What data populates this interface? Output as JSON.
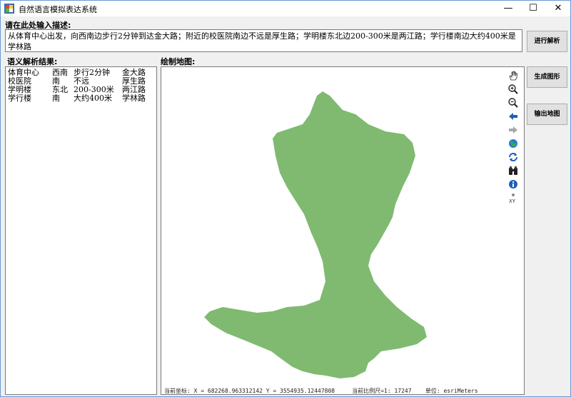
{
  "window": {
    "title": "自然语言模拟表达系统",
    "controls": {
      "minimize": "—",
      "maximize": "☐",
      "close": "✕"
    }
  },
  "labels": {
    "input_prompt": "请在此处输入描述:",
    "parse_result": "语义解析结果:",
    "draw_map": "绘制地图:"
  },
  "description": "从体育中心出发，向西南边步行2分钟到达金大路；附近的校医院南边不远是厚生路；学明楼东北边200-300米是两江路；学行楼南边大约400米是学林路",
  "results": [
    {
      "place": "体育中心",
      "direction": "西南",
      "distance": "步行2分钟",
      "road": "金大路"
    },
    {
      "place": "校医院",
      "direction": "南",
      "distance": "不远",
      "road": "厚生路"
    },
    {
      "place": "学明楼",
      "direction": "东北",
      "distance": "200-300米",
      "road": "两江路"
    },
    {
      "place": "学行楼",
      "direction": "南",
      "distance": "大约400米",
      "road": "学林路"
    }
  ],
  "buttons": {
    "parse": "进行解析",
    "generate": "生成图形",
    "export": "输出地图"
  },
  "map": {
    "fill_color": "#7fba70",
    "tools": [
      "pan-icon",
      "zoom-in-icon",
      "zoom-out-icon",
      "back-arrow-icon",
      "forward-arrow-icon",
      "globe-icon",
      "refresh-icon",
      "binoculars-icon",
      "info-icon",
      "xy-icon"
    ],
    "status": {
      "coord": "当前坐标: X = 682268.963312142  Y = 3554935.12447808",
      "scale": "当前比例尺=1: 17247",
      "unit": "单位: esriMeters"
    }
  }
}
